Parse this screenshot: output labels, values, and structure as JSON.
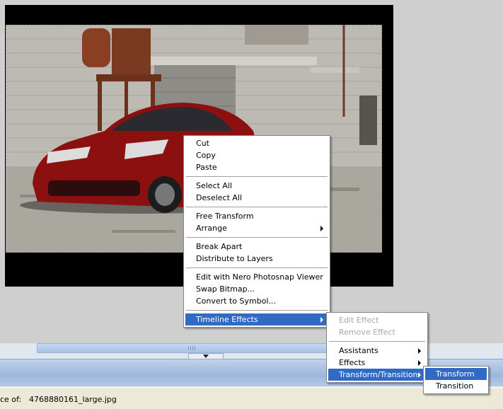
{
  "context_menu": {
    "items": [
      {
        "label": "Cut",
        "has_submenu": false
      },
      {
        "label": "Copy",
        "has_submenu": false
      },
      {
        "label": "Paste",
        "has_submenu": false
      },
      {
        "label": "Select All",
        "has_submenu": false
      },
      {
        "label": "Deselect All",
        "has_submenu": false
      },
      {
        "label": "Free Transform",
        "has_submenu": false
      },
      {
        "label": "Arrange",
        "has_submenu": true
      },
      {
        "label": "Break Apart",
        "has_submenu": false
      },
      {
        "label": "Distribute to Layers",
        "has_submenu": false
      },
      {
        "label": "Edit with Nero Photosnap Viewer",
        "has_submenu": false
      },
      {
        "label": "Swap Bitmap...",
        "has_submenu": false
      },
      {
        "label": "Convert to Symbol...",
        "has_submenu": false
      },
      {
        "label": "Timeline Effects",
        "has_submenu": true,
        "highlighted": true
      }
    ]
  },
  "timeline_effects_submenu": {
    "items": [
      {
        "label": "Edit Effect",
        "disabled": true
      },
      {
        "label": "Remove Effect",
        "disabled": true
      },
      {
        "label": "Assistants",
        "has_submenu": true
      },
      {
        "label": "Effects",
        "has_submenu": true
      },
      {
        "label": "Transform/Transition",
        "has_submenu": true,
        "highlighted": true
      }
    ]
  },
  "transform_transition_submenu": {
    "items": [
      {
        "label": "Transform",
        "highlighted": true
      },
      {
        "label": "Transition"
      }
    ]
  },
  "status_bar": {
    "label": "ce of:",
    "filename": "4768880161_large.jpg"
  },
  "colors": {
    "menu_highlight": "#316ac5",
    "stage_background": "#cfcfcf",
    "document_frame": "#000000"
  }
}
